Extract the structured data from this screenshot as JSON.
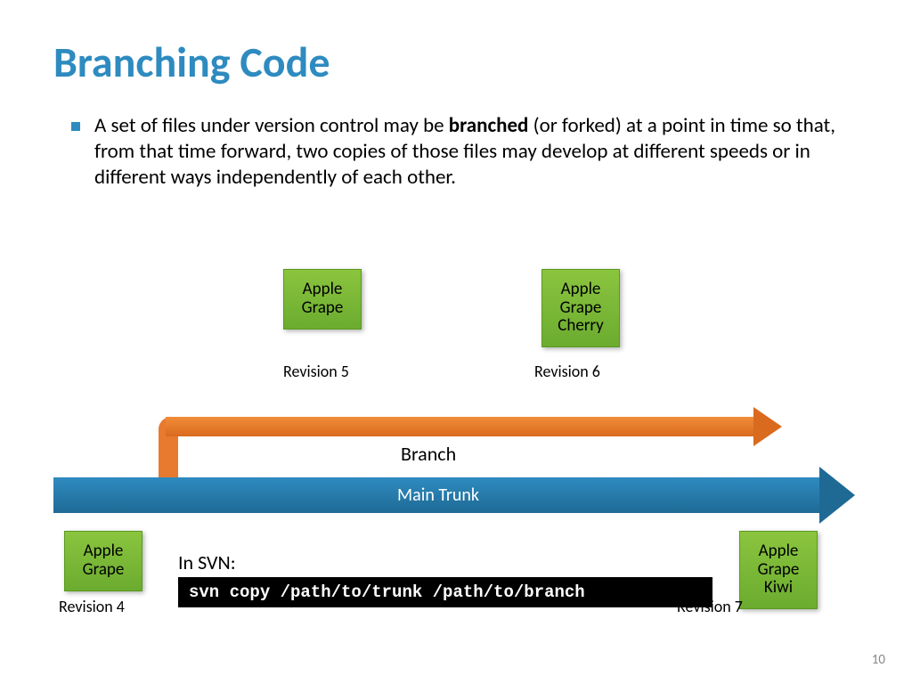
{
  "title": "Branching Code",
  "bullet": {
    "pre": "A set of files under version control may be ",
    "bold": "branched",
    "post": " (or forked) at a point in time so that, from that time forward, two copies of those files may develop at different speeds or in different ways independently of each other."
  },
  "boxes": {
    "rev4": {
      "line1": "Apple",
      "line2": "Grape",
      "label": "Revision 4"
    },
    "rev5": {
      "line1": "Apple",
      "line2": "Grape",
      "label": "Revision 5"
    },
    "rev6": {
      "line1": "Apple",
      "line2": "Grape",
      "line3": "Cherry",
      "label": "Revision 6"
    },
    "rev7": {
      "line1": "Apple",
      "line2": "Grape",
      "line3": "Kiwi",
      "label": "Revision 7"
    }
  },
  "arrows": {
    "trunk": "Main Trunk",
    "branch": "Branch"
  },
  "svn": {
    "label": "In SVN:",
    "code": "svn copy /path/to/trunk /path/to/branch"
  },
  "pageNumber": "10"
}
